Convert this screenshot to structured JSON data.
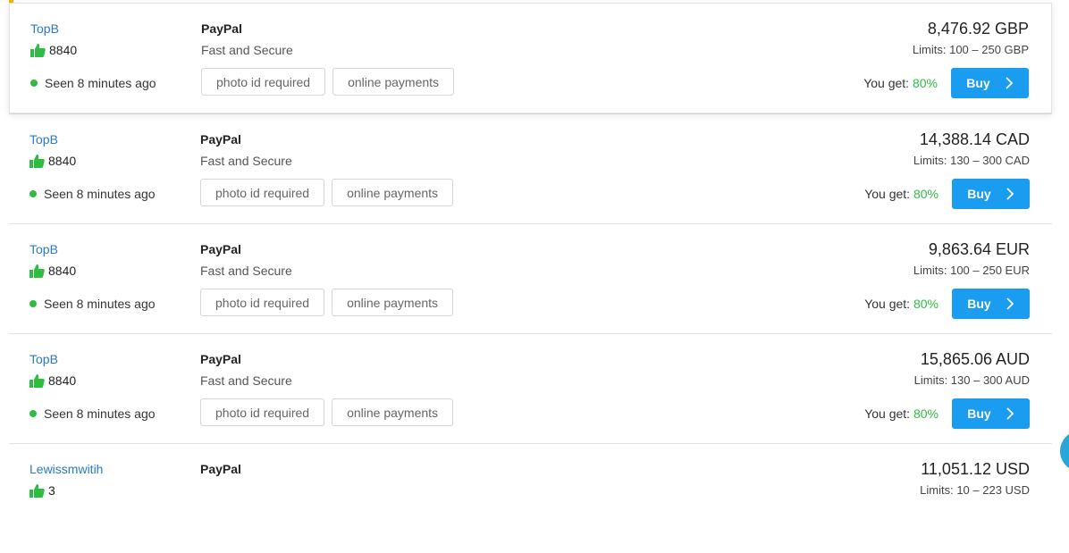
{
  "colors": {
    "accent": "#1a9cf0",
    "seller_link": "#2b78c5",
    "online_dot": "#2ebd42",
    "percent_green": "#2ebd42"
  },
  "offers": [
    {
      "seller": "TopB",
      "rating": "8840",
      "seen": "Seen 8 minutes ago",
      "method": "PayPal",
      "description": "Fast and Secure",
      "tags": [
        "photo id required",
        "online payments"
      ],
      "amount": "8,476.92 GBP",
      "limits": "Limits: 100 – 250 GBP",
      "you_get_label": "You get:",
      "you_get_pct": "80%",
      "buy_label": "Buy"
    },
    {
      "seller": "TopB",
      "rating": "8840",
      "seen": "Seen 8 minutes ago",
      "method": "PayPal",
      "description": "Fast and Secure",
      "tags": [
        "photo id required",
        "online payments"
      ],
      "amount": "14,388.14 CAD",
      "limits": "Limits: 130 – 300 CAD",
      "you_get_label": "You get:",
      "you_get_pct": "80%",
      "buy_label": "Buy"
    },
    {
      "seller": "TopB",
      "rating": "8840",
      "seen": "Seen 8 minutes ago",
      "method": "PayPal",
      "description": "Fast and Secure",
      "tags": [
        "photo id required",
        "online payments"
      ],
      "amount": "9,863.64 EUR",
      "limits": "Limits: 100 – 250 EUR",
      "you_get_label": "You get:",
      "you_get_pct": "80%",
      "buy_label": "Buy"
    },
    {
      "seller": "TopB",
      "rating": "8840",
      "seen": "Seen 8 minutes ago",
      "method": "PayPal",
      "description": "Fast and Secure",
      "tags": [
        "photo id required",
        "online payments"
      ],
      "amount": "15,865.06 AUD",
      "limits": "Limits: 130 – 300 AUD",
      "you_get_label": "You get:",
      "you_get_pct": "80%",
      "buy_label": "Buy"
    },
    {
      "seller": "Lewissmwitih",
      "rating": "3",
      "method": "PayPal",
      "amount": "11,051.12 USD",
      "limits": "Limits: 10 – 223 USD"
    }
  ],
  "icons": {
    "thumb": "thumbs-up-icon",
    "chevron": "chevron-right-icon",
    "online": "online-status-dot"
  }
}
